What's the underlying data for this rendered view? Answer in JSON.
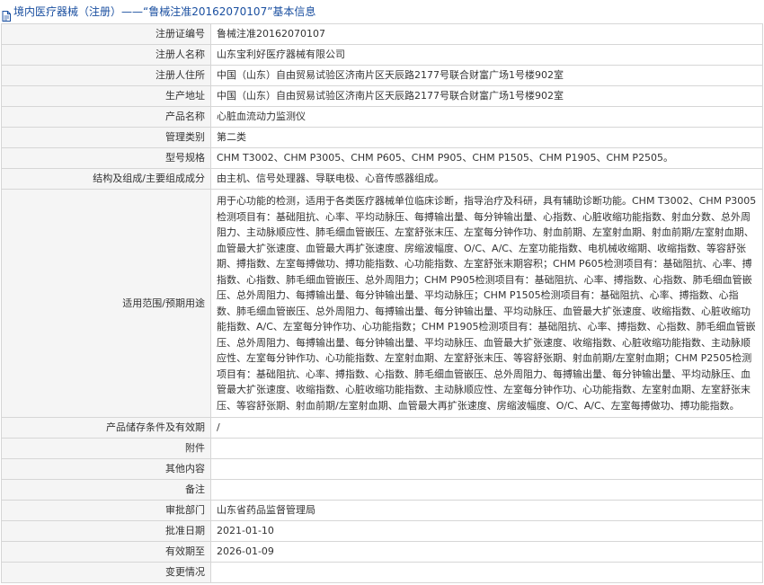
{
  "header": {
    "title": "境内医疗器械（注册）——“鲁械注准20162070107”基本信息"
  },
  "rows": [
    {
      "label": "注册证编号",
      "value": "鲁械注准20162070107"
    },
    {
      "label": "注册人名称",
      "value": "山东宝利好医疗器械有限公司"
    },
    {
      "label": "注册人住所",
      "value": "中国（山东）自由贸易试验区济南片区天辰路2177号联合财富广场1号楼902室"
    },
    {
      "label": "生产地址",
      "value": "中国（山东）自由贸易试验区济南片区天辰路2177号联合财富广场1号楼902室"
    },
    {
      "label": "产品名称",
      "value": "心脏血流动力监测仪"
    },
    {
      "label": "管理类别",
      "value": "第二类"
    },
    {
      "label": "型号规格",
      "value": "CHM T3002、CHM P3005、CHM P605、CHM P905、CHM P1505、CHM P1905、CHM P2505。"
    },
    {
      "label": "结构及组成/主要组成成分",
      "value": "由主机、信号处理器、导联电极、心音传感器组成。"
    },
    {
      "label": "适用范围/预期用途",
      "value": "用于心功能的检测，适用于各类医疗器械单位临床诊断，指导治疗及科研，具有辅助诊断功能。CHM T3002、CHM P3005检测项目有：基础阻抗、心率、平均动脉压、每搏输出量、每分钟输出量、心指数、心脏收缩功能指数、射血分数、总外周阻力、主动脉顺应性、肺毛细血管嵌压、左室舒张末压、左室每分钟作功、射血前期、左室射血期、射血前期/左室射血期、血管最大扩张速度、血管最大再扩张速度、房缩波幅度、O/C、A/C、左室功能指数、电机械收缩期、收缩指数、等容舒张期、搏指数、左室每搏做功、搏功能指数、心功能指数、左室舒张末期容积；CHM P605检测项目有：基础阻抗、心率、搏指数、心指数、肺毛细血管嵌压、总外周阻力；CHM P905检测项目有：基础阻抗、心率、搏指数、心指数、肺毛细血管嵌压、总外周阻力、每搏输出量、每分钟输出量、平均动脉压；CHM P1505检测项目有：基础阻抗、心率、搏指数、心指数、肺毛细血管嵌压、总外周阻力、每搏输出量、每分钟输出量、平均动脉压、血管最大扩张速度、收缩指数、心脏收缩功能指数、A/C、左室每分钟作功、心功能指数；CHM P1905检测项目有：基础阻抗、心率、搏指数、心指数、肺毛细血管嵌压、总外周阻力、每搏输出量、每分钟输出量、平均动脉压、血管最大扩张速度、收缩指数、心脏收缩功能指数、主动脉顺应性、左室每分钟作功、心功能指数、左室射血期、左室舒张末压、等容舒张期、射血前期/左室射血期；CHM P2505检测项目有：基础阻抗、心率、搏指数、心指数、肺毛细血管嵌压、总外周阻力、每搏输出量、每分钟输出量、平均动脉压、血管最大扩张速度、收缩指数、心脏收缩功能指数、主动脉顺应性、左室每分钟作功、心功能指数、左室射血期、左室舒张末压、等容舒张期、射血前期/左室射血期、血管最大再扩张速度、房缩波幅度、O/C、A/C、左室每搏做功、搏功能指数。"
    },
    {
      "label": "产品储存条件及有效期",
      "value": "/"
    },
    {
      "label": "附件",
      "value": ""
    },
    {
      "label": "其他内容",
      "value": ""
    },
    {
      "label": "备注",
      "value": ""
    },
    {
      "label": "审批部门",
      "value": "山东省药品监督管理局"
    },
    {
      "label": "批准日期",
      "value": "2021-01-10"
    },
    {
      "label": "有效期至",
      "value": "2026-01-09"
    },
    {
      "label": "变更情况",
      "value": ""
    }
  ]
}
